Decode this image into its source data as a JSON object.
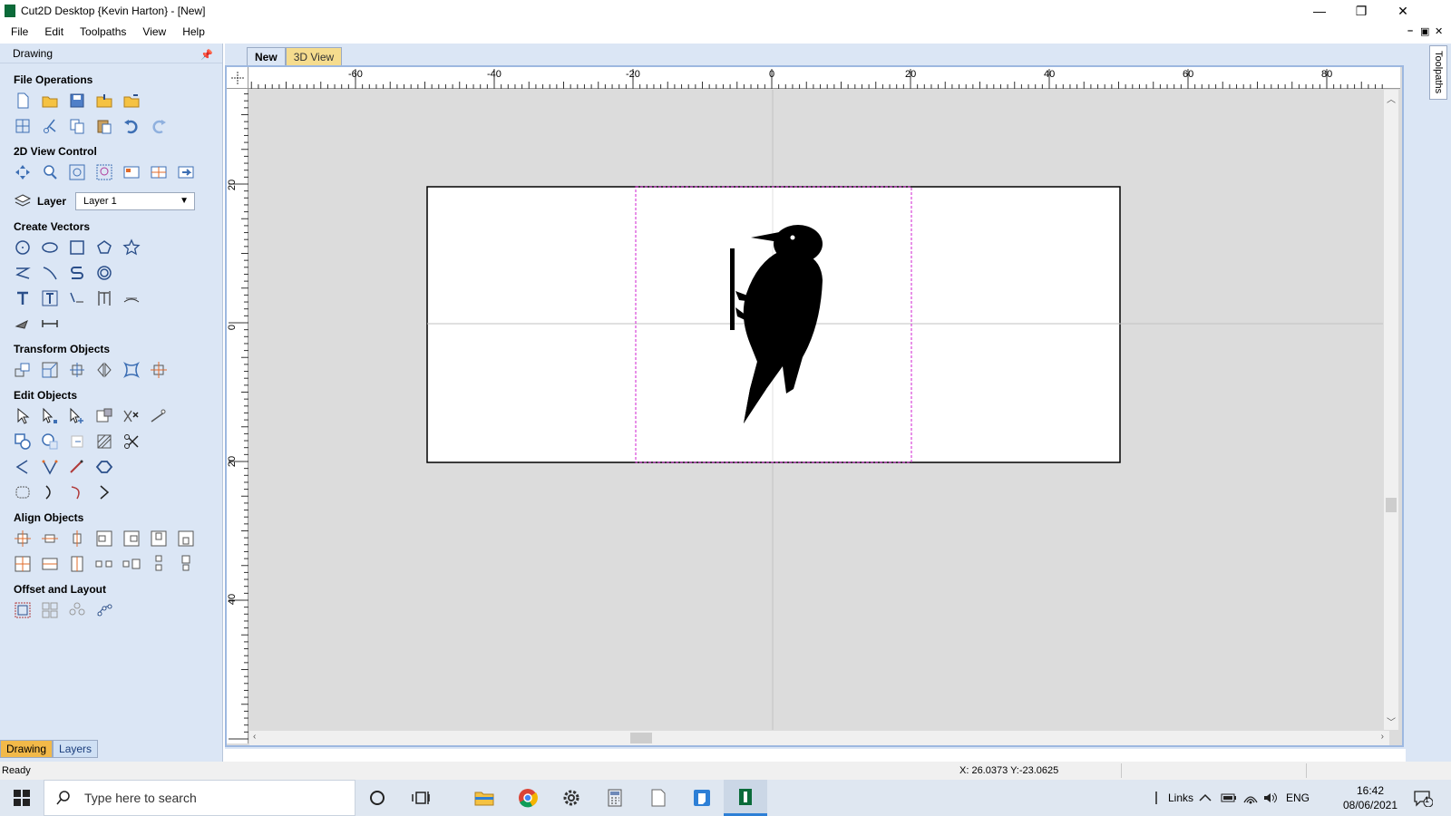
{
  "window": {
    "title": "Cut2D Desktop {Kevin Harton} - [New]",
    "minimize": "—",
    "restore": "❐",
    "close": "✕"
  },
  "menu": [
    "File",
    "Edit",
    "Toolpaths",
    "View",
    "Help"
  ],
  "mdi_controls": {
    "minimize": "–",
    "restore": "▣",
    "close": "✕"
  },
  "left_panel": {
    "title": "Drawing",
    "sections": {
      "file_operations": "File Operations",
      "view_control": "2D View Control",
      "create_vectors": "Create Vectors",
      "transform_objects": "Transform Objects",
      "edit_objects": "Edit Objects",
      "align_objects": "Align Objects",
      "offset_layout": "Offset and Layout"
    },
    "layer_label": "Layer",
    "layer_value": "Layer 1",
    "tabs": [
      "Drawing",
      "Layers"
    ]
  },
  "doc_tabs": [
    "New",
    "3D View"
  ],
  "right_dock": {
    "tab": "Toolpaths"
  },
  "rulers": {
    "top_labels": [
      "-60",
      "-40",
      "-20",
      "0",
      "20",
      "40",
      "60",
      "80"
    ],
    "left_labels": [
      "20",
      "0",
      "20",
      "40"
    ]
  },
  "status": {
    "text": "Ready",
    "coordinates": "X: 26.0373 Y:-23.0625"
  },
  "taskbar": {
    "search_placeholder": "Type here to search",
    "links": "Links",
    "language": "ENG",
    "time": "16:42",
    "date": "08/06/2021",
    "notifications": "1"
  },
  "colors": {
    "panel_bg": "#dbe6f5",
    "active_tab": "#f2b949",
    "selection_box": "#d020d0",
    "brand": "#0b6b3a"
  }
}
